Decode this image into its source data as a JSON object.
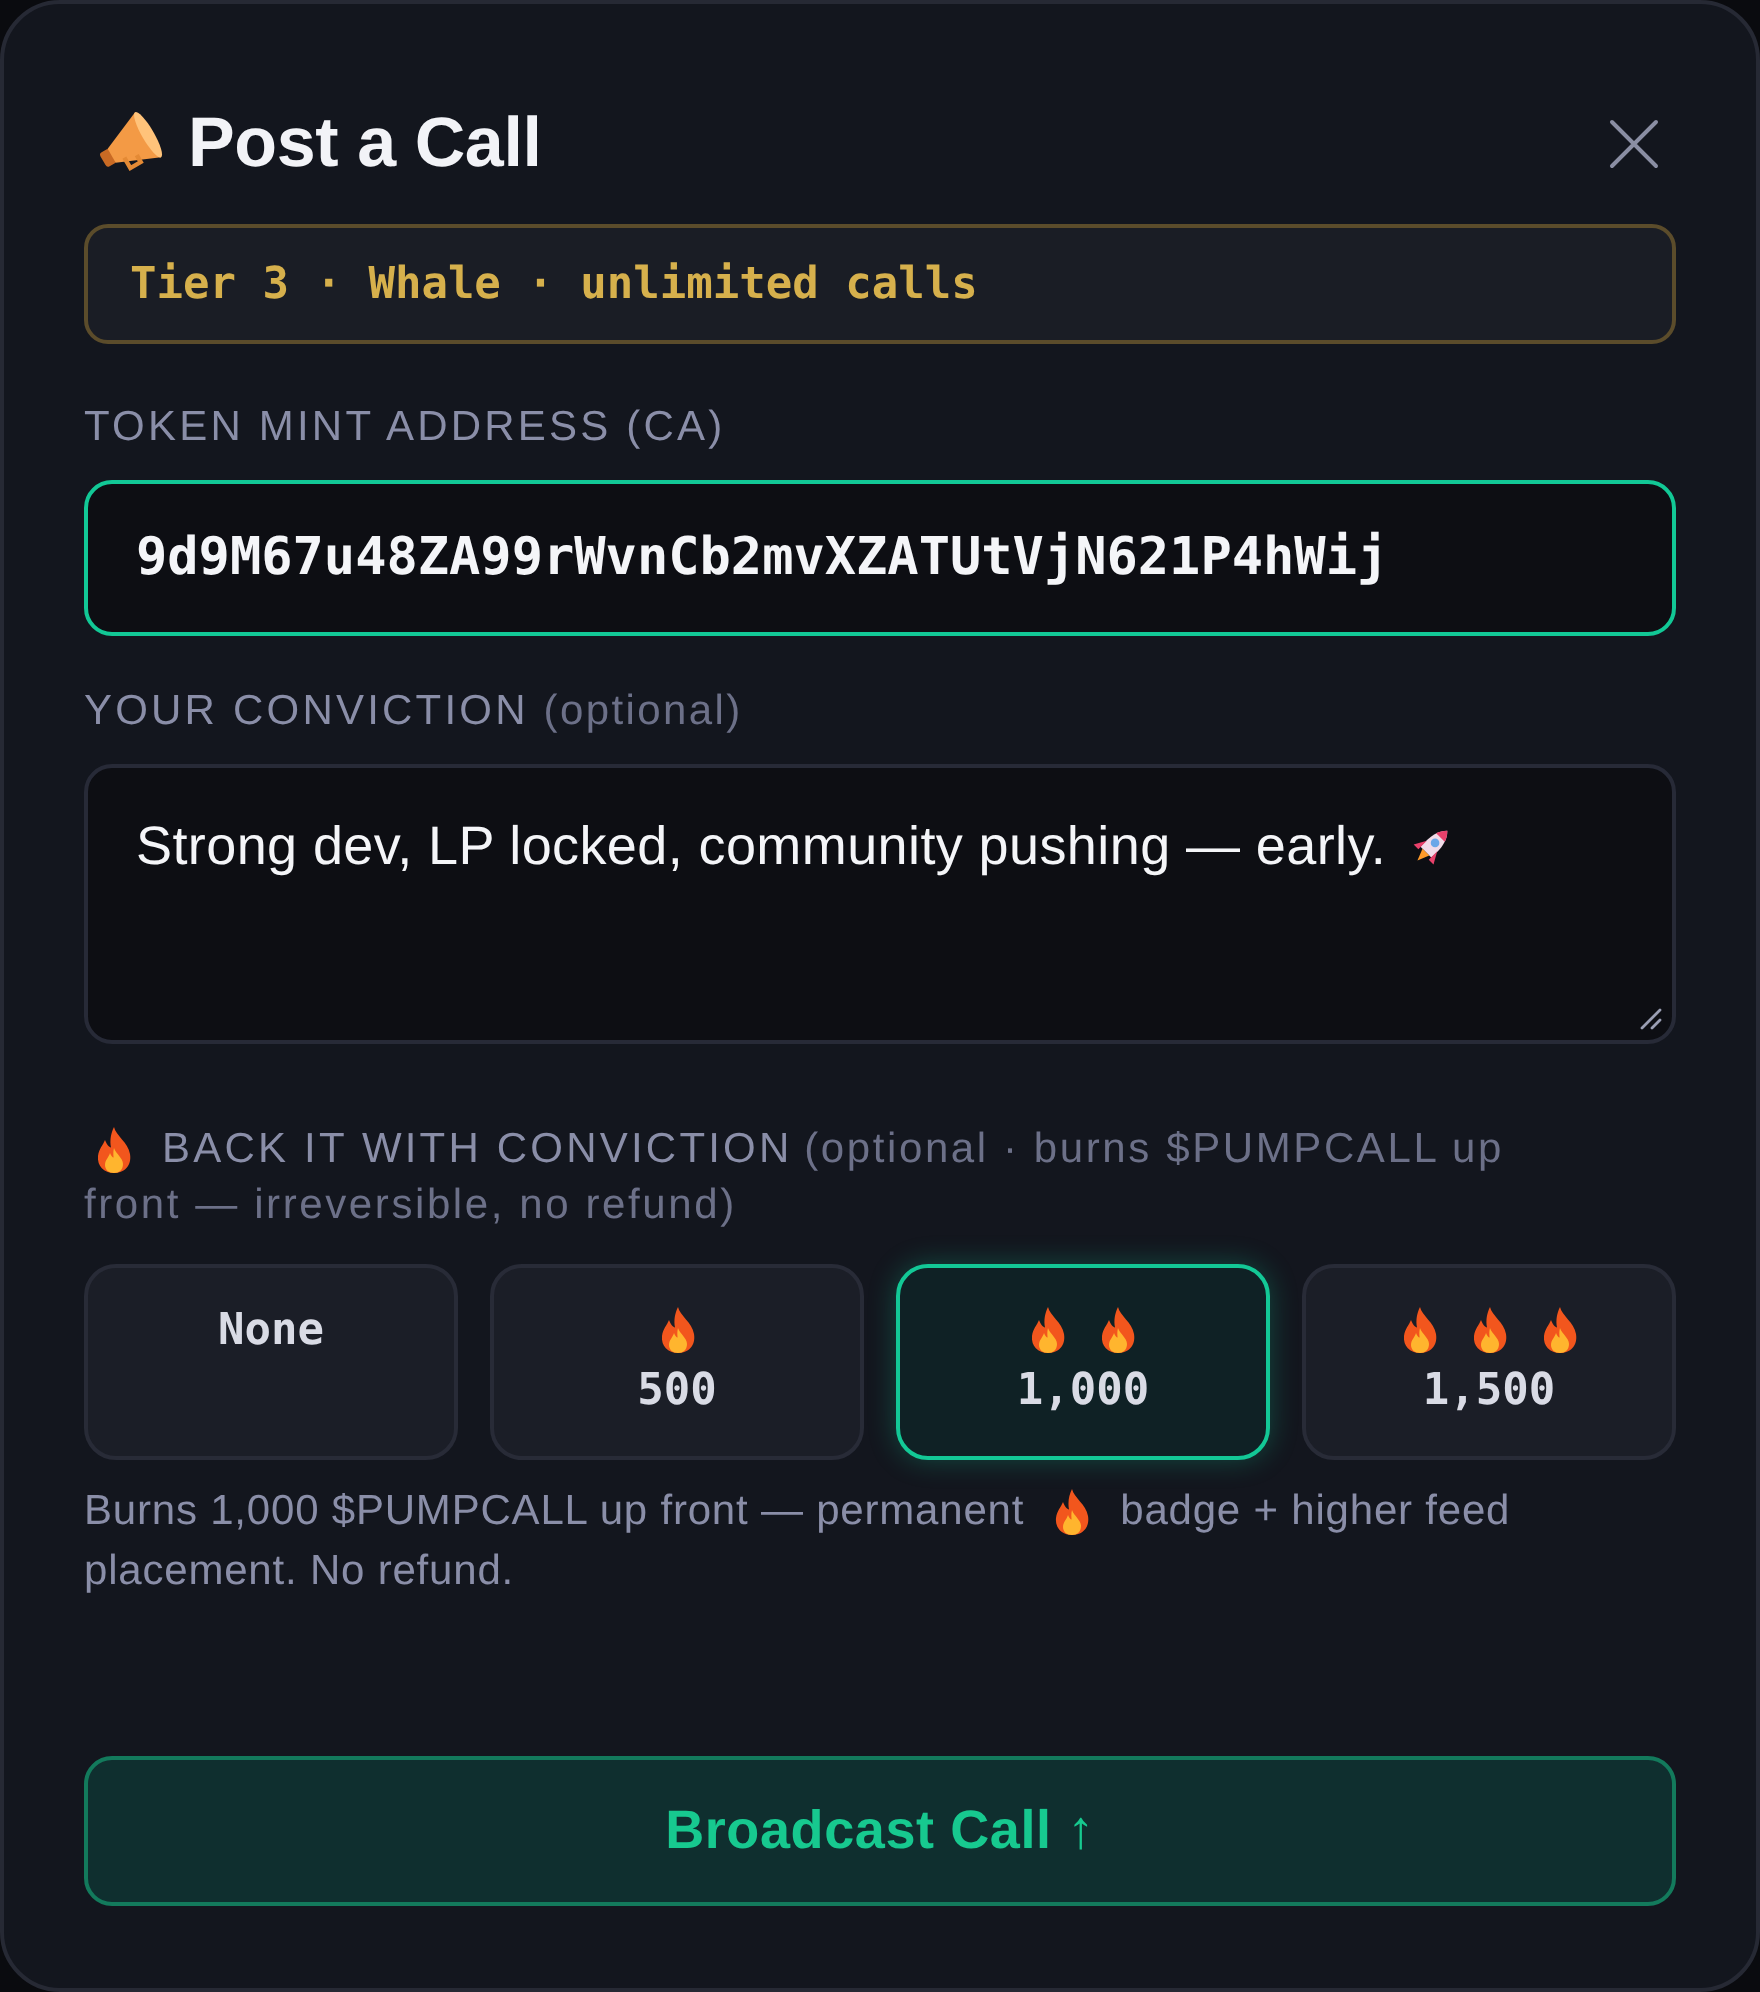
{
  "header": {
    "title": "Post a Call"
  },
  "tier_banner": "Tier 3 · Whale · unlimited calls",
  "mint_field": {
    "label": "TOKEN MINT ADDRESS (CA)",
    "value": "9d9M67u48ZA99rWvnCb2mvXZATUtVjN621P4hWij",
    "focused": true
  },
  "conviction_field": {
    "label": "YOUR CONVICTION",
    "hint": "(optional)",
    "value": "Strong dev, LP locked, community pushing — early.",
    "focused": false
  },
  "burn": {
    "label": "BACK IT WITH CONVICTION",
    "hint_line_1": "(optional · burns $PUMPCALL up",
    "hint_line_2": "front — irreversible, no refund)",
    "options": [
      {
        "label": "None",
        "selected": false
      },
      {
        "label": "500",
        "selected": false
      },
      {
        "label": "1,000",
        "selected": true
      },
      {
        "label": "1,500",
        "selected": false
      }
    ],
    "note": {
      "line_1_before": "Burns 1,000 $PUMPCALL up front — permanent",
      "line_1_after": "badge + higher feed",
      "line_2": "placement. No refund."
    }
  },
  "submit_button": {
    "label": "Broadcast Call ↑"
  }
}
